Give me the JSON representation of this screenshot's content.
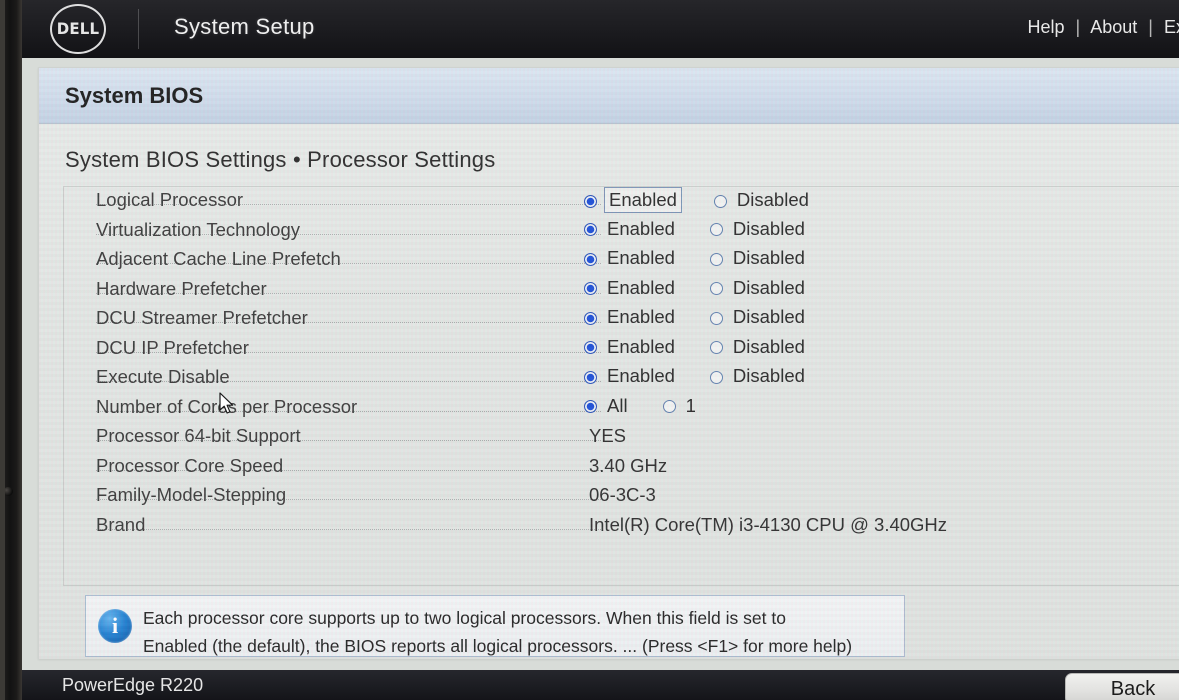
{
  "header": {
    "logo_text": "DELL",
    "title": "System Setup",
    "links": [
      {
        "label": "Help"
      },
      {
        "label": "About"
      },
      {
        "label": "Ex"
      }
    ],
    "separator": "|"
  },
  "page": {
    "title_band": "System BIOS",
    "breadcrumb": "System BIOS Settings • Processor Settings"
  },
  "settings": {
    "rows": [
      {
        "label": "Logical Processor",
        "type": "radio",
        "options": [
          "Enabled",
          "Disabled"
        ],
        "selected": 0,
        "focused": true
      },
      {
        "label": "Virtualization Technology",
        "type": "radio",
        "options": [
          "Enabled",
          "Disabled"
        ],
        "selected": 0,
        "focused": false
      },
      {
        "label": "Adjacent Cache Line Prefetch",
        "type": "radio",
        "options": [
          "Enabled",
          "Disabled"
        ],
        "selected": 0,
        "focused": false
      },
      {
        "label": "Hardware Prefetcher",
        "type": "radio",
        "options": [
          "Enabled",
          "Disabled"
        ],
        "selected": 0,
        "focused": false
      },
      {
        "label": "DCU Streamer Prefetcher",
        "type": "radio",
        "options": [
          "Enabled",
          "Disabled"
        ],
        "selected": 0,
        "focused": false
      },
      {
        "label": "DCU IP Prefetcher",
        "type": "radio",
        "options": [
          "Enabled",
          "Disabled"
        ],
        "selected": 0,
        "focused": false
      },
      {
        "label": "Execute Disable",
        "type": "radio",
        "options": [
          "Enabled",
          "Disabled"
        ],
        "selected": 0,
        "focused": false
      },
      {
        "label": "Number of Cores per Processor",
        "type": "radio",
        "options": [
          "All",
          "1"
        ],
        "selected": 0,
        "focused": false
      },
      {
        "label": "Processor 64-bit Support",
        "type": "value",
        "value": "YES"
      },
      {
        "label": "Processor Core Speed",
        "type": "value",
        "value": "3.40 GHz"
      },
      {
        "label": "Family-Model-Stepping",
        "type": "value",
        "value": "06-3C-3"
      },
      {
        "label": "Brand",
        "type": "value",
        "value": "Intel(R) Core(TM) i3-4130 CPU @ 3.40GHz"
      }
    ]
  },
  "help": {
    "icon": "info-icon",
    "line1": "Each processor core supports up to two logical processors. When this field is set to",
    "line2": "Enabled (the default), the BIOS reports all logical processors.  ... (Press <F1> for more help)"
  },
  "footer": {
    "model": "PowerEdge R220",
    "back_label": "Back"
  },
  "colors": {
    "accent_blue": "#1b4fd8",
    "title_band": "#cfdcec",
    "header_dark": "#1b1b1f",
    "info_blue": "#1f7fd1"
  }
}
